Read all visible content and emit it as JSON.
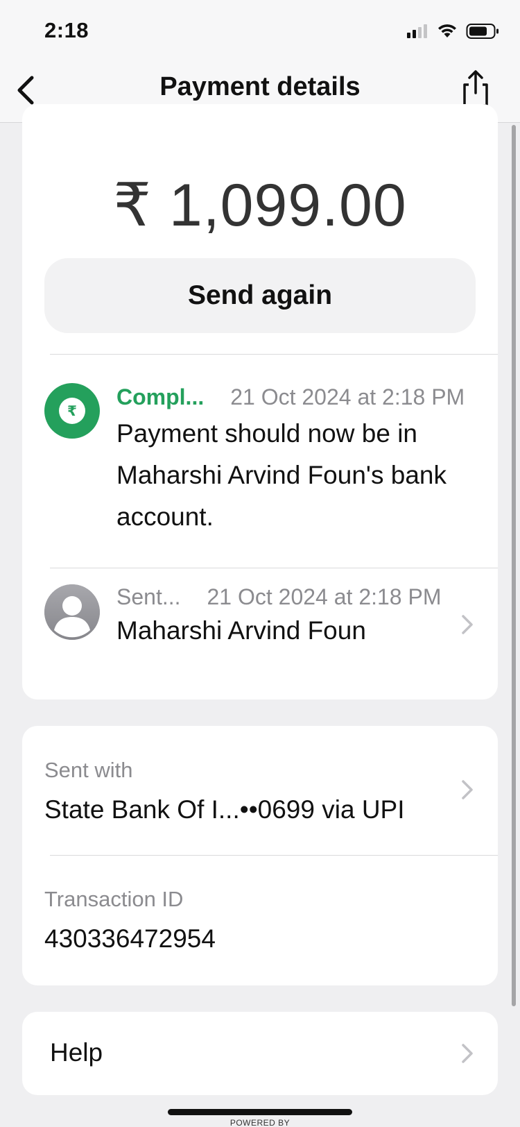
{
  "status_bar": {
    "time": "2:18"
  },
  "nav": {
    "title": "Payment details"
  },
  "payment": {
    "amount": "₹ 1,099.00",
    "send_again_label": "Send again"
  },
  "events": [
    {
      "status": "Compl...",
      "date": "21 Oct 2024 at 2:18 PM",
      "body": "Payment should now be in Maharshi Arvind Foun's bank account.",
      "icon": "rupee-icon",
      "color": "#24a05c"
    },
    {
      "status": "Sent...",
      "date": "21 Oct 2024 at 2:18 PM",
      "body": "Maharshi Arvind Foun",
      "icon": "person-avatar-icon"
    }
  ],
  "details": {
    "sent_with_label": "Sent with",
    "sent_with_value": "State Bank Of I...••0699 via UPI",
    "transaction_id_label": "Transaction ID",
    "transaction_id_value": "430336472954"
  },
  "help": {
    "label": "Help"
  },
  "footer": {
    "powered_by": "POWERED BY"
  }
}
